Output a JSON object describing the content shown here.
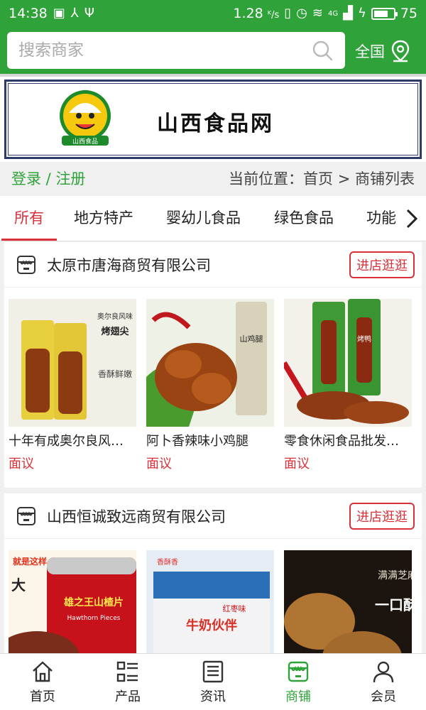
{
  "status_bar": {
    "time": "14:38",
    "speed": "1.28",
    "speed_unit": "ᴷ/s",
    "network": "4G",
    "battery": "75",
    "battery_level": 0.75
  },
  "search": {
    "placeholder": "搜索商家",
    "region_label": "全国"
  },
  "banner": {
    "title": "山西食品网",
    "logo_text": "山西食品"
  },
  "auth": {
    "login": "登录",
    "separator": " / ",
    "register": "注册"
  },
  "breadcrumb": {
    "prefix": "当前位置：",
    "home": "首页",
    "sep": " > ",
    "current": "商铺列表"
  },
  "tabs": [
    "所有",
    "地方特产",
    "婴幼儿食品",
    "绿色食品",
    "功能"
  ],
  "shops": [
    {
      "name": "太原市唐海商贸有限公司",
      "button": "进店逛逛",
      "products": [
        {
          "name": "十年有成奥尔良风味烤翅尖",
          "price": "面议",
          "img_text_1": "奥尔良风味",
          "img_text_2": "烤翅尖",
          "img_text_3": "香酥鲜嫩"
        },
        {
          "name": "阿卜香辣味小鸡腿",
          "price": "面议",
          "img_text_1": "山鸡腿"
        },
        {
          "name": "零食休闲食品批发鸭脖",
          "price": "面议",
          "img_text_1": "烤鸭"
        }
      ]
    },
    {
      "name": "山西恒诚致远商贸有限公司",
      "button": "进店逛逛",
      "products": [
        {
          "name": "",
          "price": "",
          "img_text_1": "就是这样",
          "img_text_2": "大",
          "img_text_3": "雄之王山楂片",
          "img_text_4": "Hawthorn Pieces"
        },
        {
          "name": "",
          "price": "",
          "img_text_1": "香酥香",
          "img_text_2": "红枣味",
          "img_text_3": "牛奶伙伴"
        },
        {
          "name": "",
          "price": "",
          "img_text_1": "满满芝麻",
          "img_text_2": "一口酥"
        }
      ]
    }
  ],
  "bottom_nav": [
    {
      "label": "首页",
      "icon": "home-icon"
    },
    {
      "label": "产品",
      "icon": "grid-list-icon"
    },
    {
      "label": "资讯",
      "icon": "news-icon"
    },
    {
      "label": "商铺",
      "icon": "store-icon",
      "active": true
    },
    {
      "label": "会员",
      "icon": "user-icon"
    }
  ]
}
